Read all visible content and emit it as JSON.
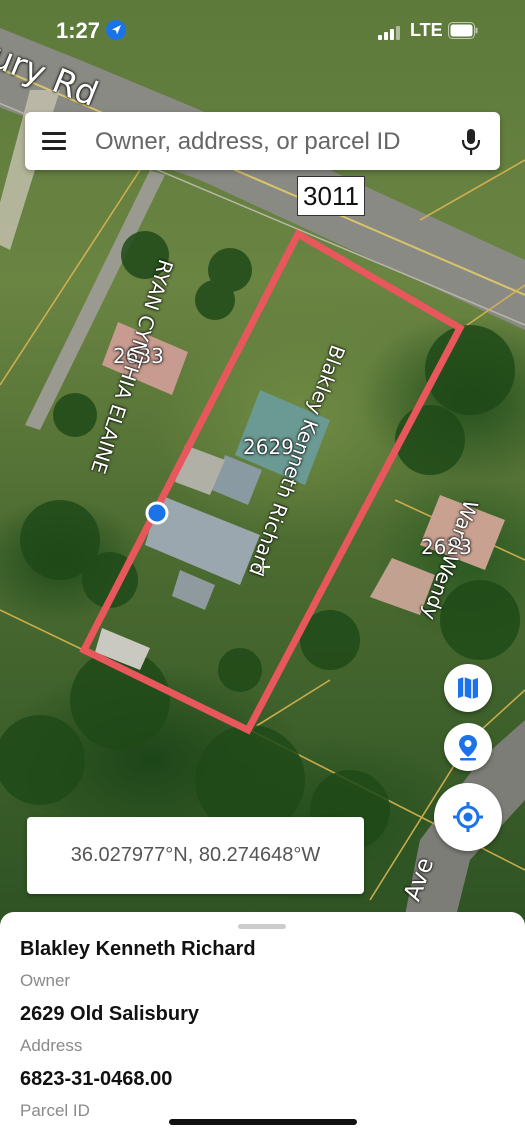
{
  "status_bar": {
    "time": "1:27",
    "network": "LTE"
  },
  "search": {
    "placeholder": "Owner, address, or parcel ID"
  },
  "map": {
    "road_name": "ury Rd",
    "route_badge": "3011",
    "street_fragment": "Ave",
    "parcel_labels": {
      "ryan": "RYAN CYNTHIA ELAINE",
      "blakley": "Blakley Kenneth Richard",
      "ward": "Ward Wendy"
    },
    "house_numbers": {
      "left": "2633",
      "center": "2629",
      "right": "2623"
    },
    "selected_parcel_color": "#e8575c"
  },
  "controls": {
    "layers_icon": "map-icon",
    "pin_icon": "pin-icon",
    "locate_icon": "crosshair-icon"
  },
  "coordinates": "36.027977°N, 80.274648°W",
  "details": {
    "owner_value": "Blakley Kenneth Richard",
    "owner_label": "Owner",
    "address_value": "2629 Old Salisbury",
    "address_label": "Address",
    "parcel_value": "6823-31-0468.00",
    "parcel_label": "Parcel ID"
  },
  "colors": {
    "accent": "#1a73e8",
    "parcel_outline": "#e8575c"
  }
}
